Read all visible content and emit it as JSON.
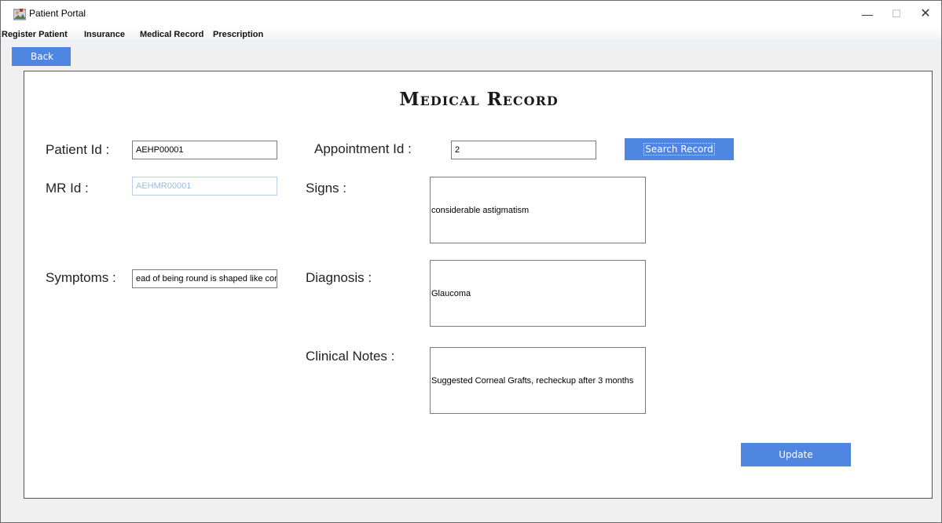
{
  "window": {
    "title": "Patient Portal",
    "minimize_glyph": "—",
    "maximize_glyph": "☐",
    "close_glyph": "✕"
  },
  "menubar": {
    "items": [
      "Register Patient",
      "Insurance",
      "Medical Record",
      "Prescription"
    ]
  },
  "toolbar": {
    "back_label": "Back"
  },
  "page": {
    "heading": "Medical Record"
  },
  "form": {
    "patient_id_label": "Patient Id :",
    "patient_id_value": "AEHP00001",
    "appointment_id_label": "Appointment Id :",
    "appointment_id_value": "2",
    "search_label": "Search Record",
    "mr_id_label": "MR Id :",
    "mr_id_value": "AEHMR00001",
    "signs_label": "Signs :",
    "signs_value": "considerable astigmatism",
    "symptoms_label": "Symptoms :",
    "symptoms_value": "ead of being round is shaped like cone",
    "diagnosis_label": "Diagnosis :",
    "diagnosis_value": "Glaucoma",
    "clinical_notes_label": "Clinical Notes :",
    "clinical_notes_value": "Suggested Corneal Grafts, recheckup after 3 months",
    "update_label": "Update"
  },
  "colors": {
    "accent": "#4f86e2",
    "disabled_text": "#9bbbe0",
    "background": "#f0f0f0",
    "panel": "#ffffff"
  },
  "icons": {
    "app": "patient-portal-app-icon"
  }
}
